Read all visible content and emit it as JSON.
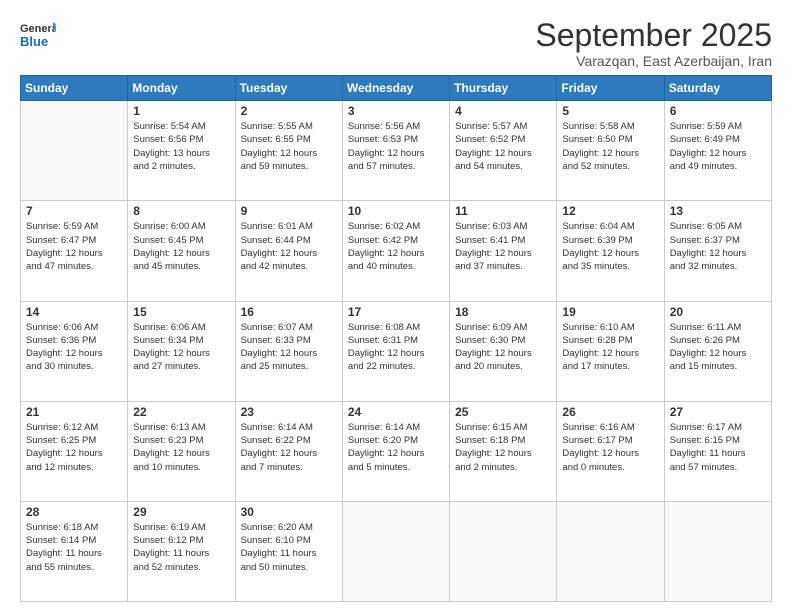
{
  "logo": {
    "text1": "General",
    "text2": "Blue"
  },
  "title": "September 2025",
  "location": "Varazqan, East Azerbaijan, Iran",
  "days_header": [
    "Sunday",
    "Monday",
    "Tuesday",
    "Wednesday",
    "Thursday",
    "Friday",
    "Saturday"
  ],
  "weeks": [
    [
      {
        "day": "",
        "info": ""
      },
      {
        "day": "1",
        "info": "Sunrise: 5:54 AM\nSunset: 6:56 PM\nDaylight: 13 hours\nand 2 minutes."
      },
      {
        "day": "2",
        "info": "Sunrise: 5:55 AM\nSunset: 6:55 PM\nDaylight: 12 hours\nand 59 minutes."
      },
      {
        "day": "3",
        "info": "Sunrise: 5:56 AM\nSunset: 6:53 PM\nDaylight: 12 hours\nand 57 minutes."
      },
      {
        "day": "4",
        "info": "Sunrise: 5:57 AM\nSunset: 6:52 PM\nDaylight: 12 hours\nand 54 minutes."
      },
      {
        "day": "5",
        "info": "Sunrise: 5:58 AM\nSunset: 6:50 PM\nDaylight: 12 hours\nand 52 minutes."
      },
      {
        "day": "6",
        "info": "Sunrise: 5:59 AM\nSunset: 6:49 PM\nDaylight: 12 hours\nand 49 minutes."
      }
    ],
    [
      {
        "day": "7",
        "info": "Sunrise: 5:59 AM\nSunset: 6:47 PM\nDaylight: 12 hours\nand 47 minutes."
      },
      {
        "day": "8",
        "info": "Sunrise: 6:00 AM\nSunset: 6:45 PM\nDaylight: 12 hours\nand 45 minutes."
      },
      {
        "day": "9",
        "info": "Sunrise: 6:01 AM\nSunset: 6:44 PM\nDaylight: 12 hours\nand 42 minutes."
      },
      {
        "day": "10",
        "info": "Sunrise: 6:02 AM\nSunset: 6:42 PM\nDaylight: 12 hours\nand 40 minutes."
      },
      {
        "day": "11",
        "info": "Sunrise: 6:03 AM\nSunset: 6:41 PM\nDaylight: 12 hours\nand 37 minutes."
      },
      {
        "day": "12",
        "info": "Sunrise: 6:04 AM\nSunset: 6:39 PM\nDaylight: 12 hours\nand 35 minutes."
      },
      {
        "day": "13",
        "info": "Sunrise: 6:05 AM\nSunset: 6:37 PM\nDaylight: 12 hours\nand 32 minutes."
      }
    ],
    [
      {
        "day": "14",
        "info": "Sunrise: 6:06 AM\nSunset: 6:36 PM\nDaylight: 12 hours\nand 30 minutes."
      },
      {
        "day": "15",
        "info": "Sunrise: 6:06 AM\nSunset: 6:34 PM\nDaylight: 12 hours\nand 27 minutes."
      },
      {
        "day": "16",
        "info": "Sunrise: 6:07 AM\nSunset: 6:33 PM\nDaylight: 12 hours\nand 25 minutes."
      },
      {
        "day": "17",
        "info": "Sunrise: 6:08 AM\nSunset: 6:31 PM\nDaylight: 12 hours\nand 22 minutes."
      },
      {
        "day": "18",
        "info": "Sunrise: 6:09 AM\nSunset: 6:30 PM\nDaylight: 12 hours\nand 20 minutes."
      },
      {
        "day": "19",
        "info": "Sunrise: 6:10 AM\nSunset: 6:28 PM\nDaylight: 12 hours\nand 17 minutes."
      },
      {
        "day": "20",
        "info": "Sunrise: 6:11 AM\nSunset: 6:26 PM\nDaylight: 12 hours\nand 15 minutes."
      }
    ],
    [
      {
        "day": "21",
        "info": "Sunrise: 6:12 AM\nSunset: 6:25 PM\nDaylight: 12 hours\nand 12 minutes."
      },
      {
        "day": "22",
        "info": "Sunrise: 6:13 AM\nSunset: 6:23 PM\nDaylight: 12 hours\nand 10 minutes."
      },
      {
        "day": "23",
        "info": "Sunrise: 6:14 AM\nSunset: 6:22 PM\nDaylight: 12 hours\nand 7 minutes."
      },
      {
        "day": "24",
        "info": "Sunrise: 6:14 AM\nSunset: 6:20 PM\nDaylight: 12 hours\nand 5 minutes."
      },
      {
        "day": "25",
        "info": "Sunrise: 6:15 AM\nSunset: 6:18 PM\nDaylight: 12 hours\nand 2 minutes."
      },
      {
        "day": "26",
        "info": "Sunrise: 6:16 AM\nSunset: 6:17 PM\nDaylight: 12 hours\nand 0 minutes."
      },
      {
        "day": "27",
        "info": "Sunrise: 6:17 AM\nSunset: 6:15 PM\nDaylight: 11 hours\nand 57 minutes."
      }
    ],
    [
      {
        "day": "28",
        "info": "Sunrise: 6:18 AM\nSunset: 6:14 PM\nDaylight: 11 hours\nand 55 minutes."
      },
      {
        "day": "29",
        "info": "Sunrise: 6:19 AM\nSunset: 6:12 PM\nDaylight: 11 hours\nand 52 minutes."
      },
      {
        "day": "30",
        "info": "Sunrise: 6:20 AM\nSunset: 6:10 PM\nDaylight: 11 hours\nand 50 minutes."
      },
      {
        "day": "",
        "info": ""
      },
      {
        "day": "",
        "info": ""
      },
      {
        "day": "",
        "info": ""
      },
      {
        "day": "",
        "info": ""
      }
    ]
  ]
}
